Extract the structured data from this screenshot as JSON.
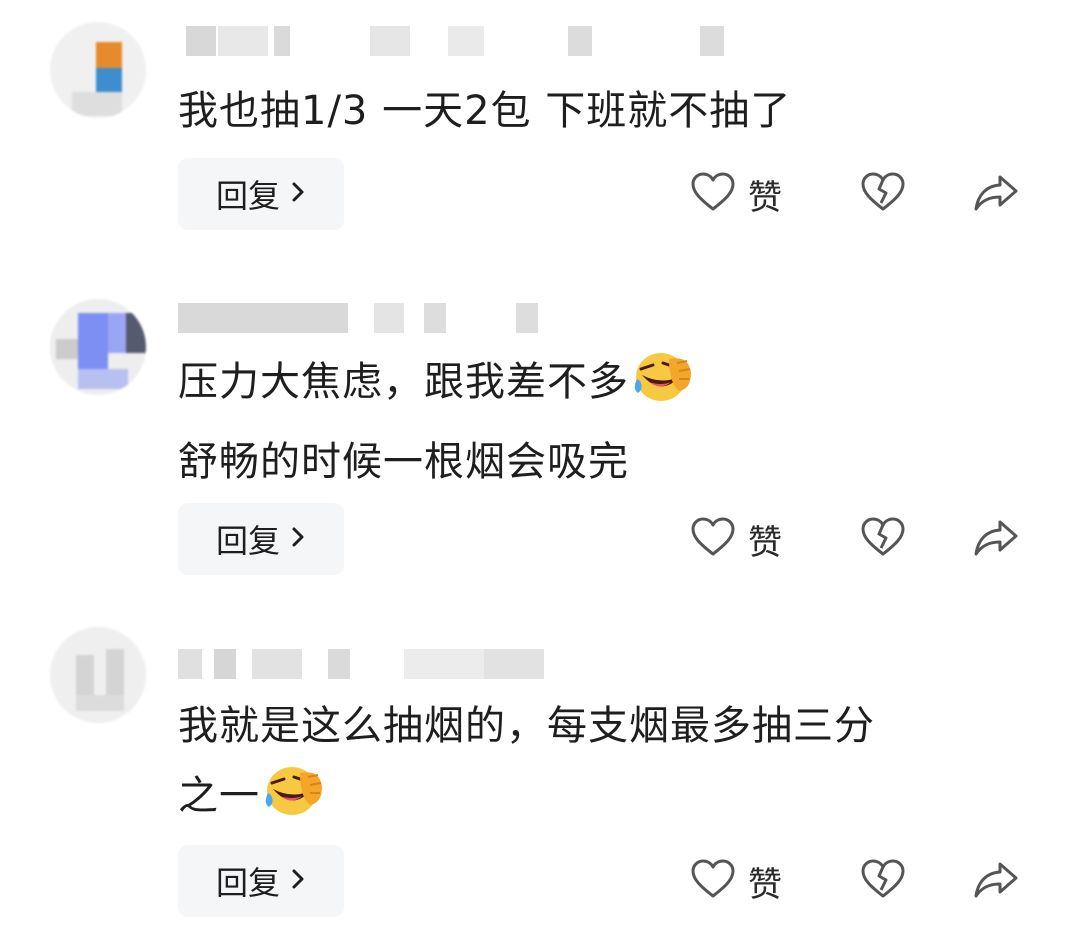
{
  "comments": [
    {
      "text_lines": [
        "我也抽1/3 一天2包 下班就不抽了"
      ],
      "emoji": "",
      "reply_label": "回复",
      "like_label": "赞"
    },
    {
      "text_lines": [
        "压力大焦虑，跟我差不多",
        "舒畅的时候一根烟会吸完"
      ],
      "emoji": "laughing-crying-emoji",
      "reply_label": "回复",
      "like_label": "赞"
    },
    {
      "text_lines": [
        "我就是这么抽烟的，每支烟最多抽三分",
        "之一"
      ],
      "emoji": "laughing-crying-emoji",
      "reply_label": "回复",
      "like_label": "赞"
    }
  ],
  "icons": {
    "like": "heart-icon",
    "dislike": "broken-heart-icon",
    "share": "share-arrow-icon",
    "reply_chevron": "chevron-right-icon"
  },
  "colors": {
    "background": "#ffffff",
    "reply_button_bg": "#f5f6f8",
    "text": "#1e1e1e",
    "icon_stroke": "#555555"
  }
}
